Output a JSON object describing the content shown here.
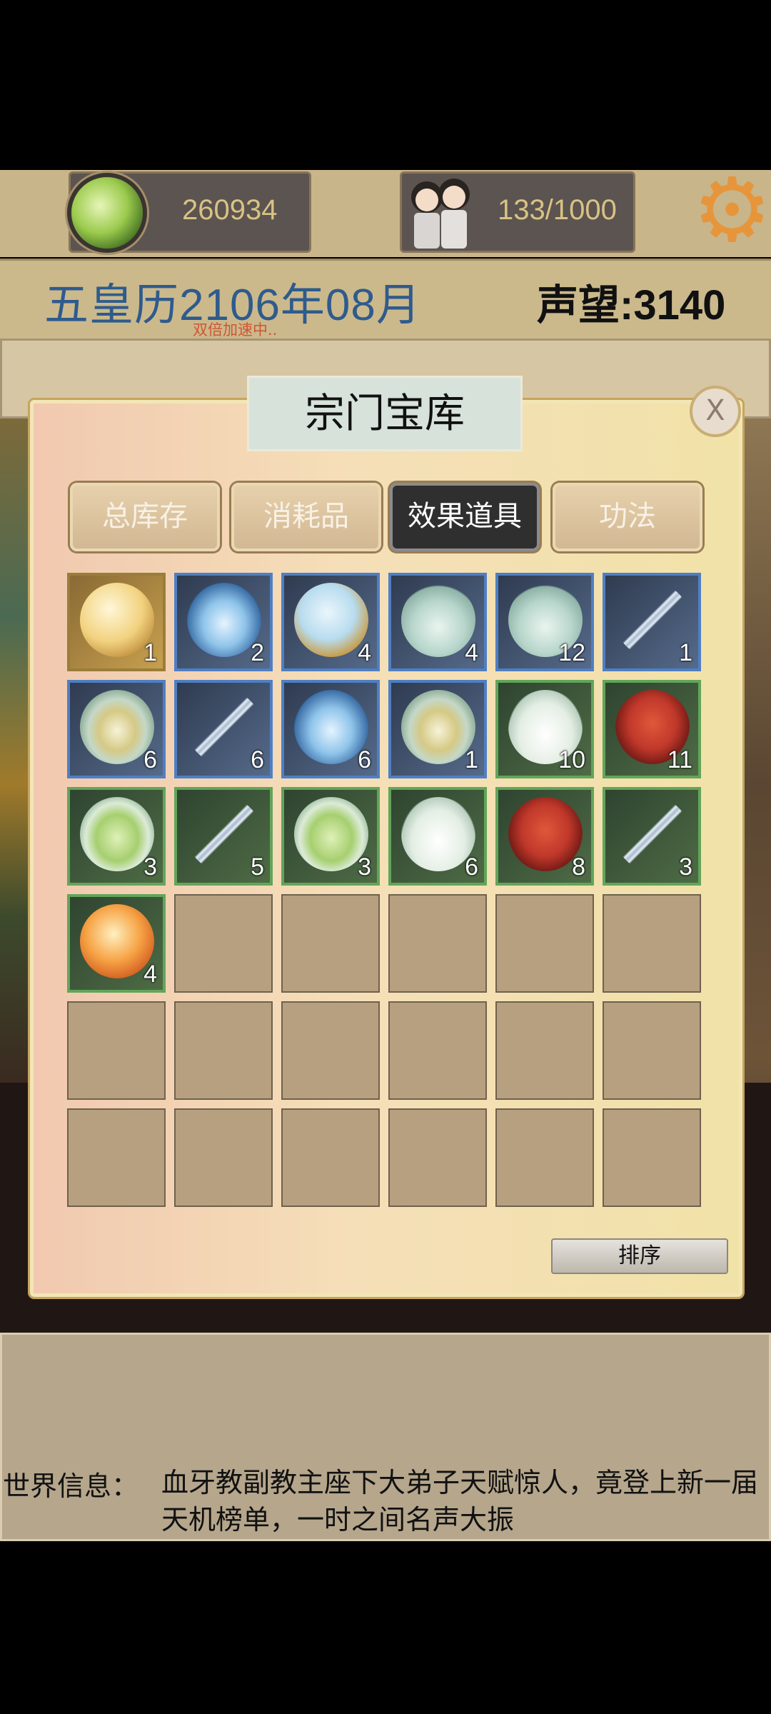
{
  "topbar": {
    "spirit_stones": "260934",
    "disciples": "133/1000"
  },
  "date_bar": {
    "date": "五皇历2106年08月",
    "speed_status": "双倍加速中..",
    "prestige": "声望:3140"
  },
  "modal": {
    "title": "宗门宝库",
    "close_label": "X",
    "tabs": [
      {
        "label": "总库存",
        "active": false
      },
      {
        "label": "消耗品",
        "active": false
      },
      {
        "label": "效果道具",
        "active": true
      },
      {
        "label": "功法",
        "active": false
      }
    ],
    "items": [
      {
        "name": "golden-pearl",
        "rarity": "gold",
        "count": "1",
        "icon": "ic-pearl"
      },
      {
        "name": "jade-disc",
        "rarity": "blue",
        "count": "2",
        "icon": "ic-jade"
      },
      {
        "name": "crystal-orb",
        "rarity": "blue",
        "count": "4",
        "icon": "ic-orb"
      },
      {
        "name": "porcelain-jug",
        "rarity": "blue",
        "count": "4",
        "icon": "ic-jug"
      },
      {
        "name": "porcelain-jug",
        "rarity": "blue",
        "count": "12",
        "icon": "ic-jug"
      },
      {
        "name": "spirit-sword",
        "rarity": "blue",
        "count": "1",
        "icon": "ic-sword"
      },
      {
        "name": "tea-bowl",
        "rarity": "blue",
        "count": "6",
        "icon": "ic-tea"
      },
      {
        "name": "spirit-sword",
        "rarity": "blue",
        "count": "6",
        "icon": "ic-sword"
      },
      {
        "name": "jade-disc",
        "rarity": "blue",
        "count": "6",
        "icon": "ic-jade"
      },
      {
        "name": "tea-bowl",
        "rarity": "blue",
        "count": "1",
        "icon": "ic-tea"
      },
      {
        "name": "wine-gourd",
        "rarity": "green",
        "count": "10",
        "icon": "ic-wine"
      },
      {
        "name": "red-rice",
        "rarity": "green",
        "count": "11",
        "icon": "ic-rice"
      },
      {
        "name": "green-tea",
        "rarity": "green",
        "count": "3",
        "icon": "ic-tea-green"
      },
      {
        "name": "spirit-sword",
        "rarity": "green",
        "count": "5",
        "icon": "ic-sword"
      },
      {
        "name": "green-tea",
        "rarity": "green",
        "count": "3",
        "icon": "ic-tea-green"
      },
      {
        "name": "wine-gourd",
        "rarity": "green",
        "count": "6",
        "icon": "ic-wine"
      },
      {
        "name": "red-rice",
        "rarity": "green",
        "count": "8",
        "icon": "ic-rice"
      },
      {
        "name": "spirit-sword",
        "rarity": "green",
        "count": "3",
        "icon": "ic-sword"
      },
      {
        "name": "fire-orb",
        "rarity": "green",
        "count": "4",
        "icon": "ic-fire"
      }
    ],
    "grid_columns": 6,
    "grid_rows": 6,
    "sort_label": "排序"
  },
  "world_message": {
    "label": "世界信息：",
    "text": "血牙教副教主座下大弟子天赋惊人，竟登上新一届天机榜单，一时之间名声大振"
  }
}
